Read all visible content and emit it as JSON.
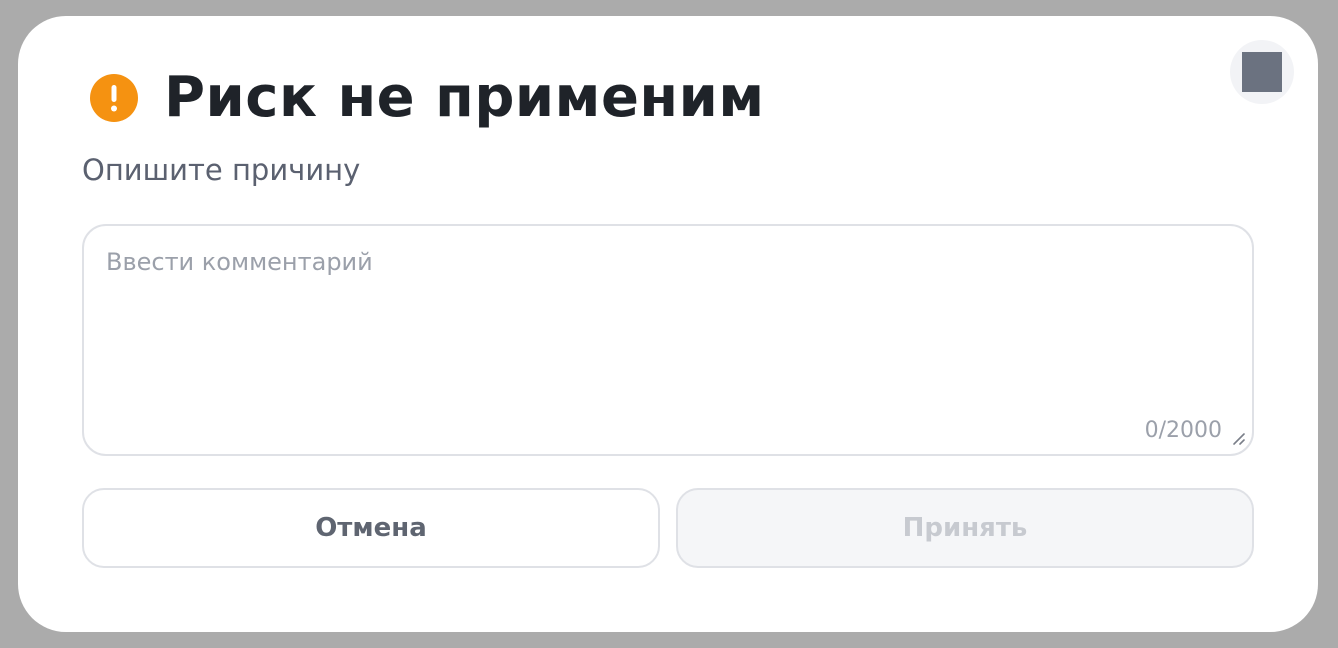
{
  "dialog": {
    "title": "Риск не применим",
    "subtitle": "Опишите причину",
    "icon": "warning-icon",
    "accent_color": "#f59211"
  },
  "comment": {
    "value": "",
    "placeholder": "Ввести комментарий",
    "counter": "0/2000"
  },
  "buttons": {
    "cancel_label": "Отмена",
    "accept_label": "Принять"
  },
  "close": {
    "icon": "close-icon"
  }
}
